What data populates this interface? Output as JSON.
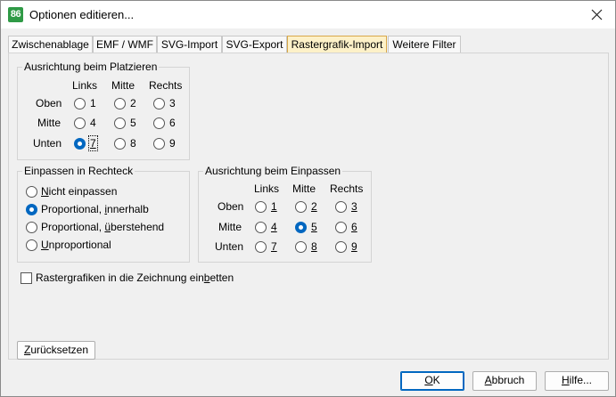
{
  "window": {
    "title": "Optionen editieren...",
    "app_icon_text": "86",
    "close_icon": "close-icon"
  },
  "tabs": [
    {
      "label": "Zwischenablage"
    },
    {
      "label": "EMF / WMF"
    },
    {
      "label": "SVG-Import"
    },
    {
      "label": "SVG-Export"
    },
    {
      "label": "Rastergrafik-Import",
      "active": true
    },
    {
      "label": "Weitere Filter"
    }
  ],
  "placement": {
    "title": "Ausrichtung beim Platzieren",
    "columns": [
      "Links",
      "Mitte",
      "Rechts"
    ],
    "rows": [
      "Oben",
      "Mitte",
      "Unten"
    ],
    "options": [
      "1",
      "2",
      "3",
      "4",
      "5",
      "6",
      "7",
      "8",
      "9"
    ],
    "selected": "7"
  },
  "fit_rect": {
    "title": "Einpassen in Rechteck",
    "options": [
      {
        "pre": "",
        "key": "N",
        "post": "icht einpassen"
      },
      {
        "pre": "Proportional, ",
        "key": "i",
        "post": "nnerhalb"
      },
      {
        "pre": "Proportional, ",
        "key": "ü",
        "post": "berstehend"
      },
      {
        "pre": "",
        "key": "U",
        "post": "nproportional"
      }
    ],
    "selected_index": 1
  },
  "fit_align": {
    "title": "Ausrichtung beim Einpassen",
    "columns": [
      "Links",
      "Mitte",
      "Rechts"
    ],
    "rows": [
      "Oben",
      "Mitte",
      "Unten"
    ],
    "options": [
      "1",
      "2",
      "3",
      "4",
      "5",
      "6",
      "7",
      "8",
      "9"
    ],
    "selected": "5"
  },
  "embed": {
    "pre": "Rastergrafiken in die Zeichnung ein",
    "key": "b",
    "post": "etten",
    "checked": false
  },
  "buttons": {
    "reset": {
      "pre": "",
      "key": "Z",
      "post": "urücksetzen"
    },
    "ok": {
      "pre": "",
      "key": "O",
      "post": "K"
    },
    "cancel": {
      "pre": "",
      "key": "A",
      "post": "bbruch"
    },
    "help": {
      "pre": "",
      "key": "H",
      "post": "ilfe..."
    }
  },
  "colors": {
    "accent": "#0067c0",
    "active_tab_bg": "#fdf1c8",
    "active_tab_border": "#d8a84a",
    "app_icon": "#2f9a46"
  }
}
